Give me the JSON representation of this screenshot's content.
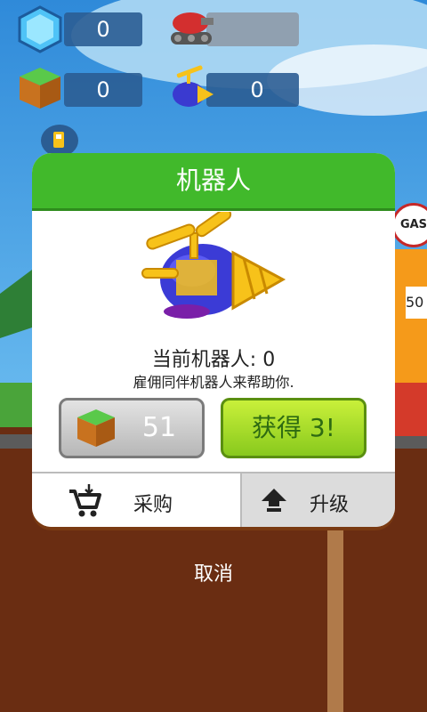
{
  "hud": {
    "gems_count": "0",
    "blocks_count": "0",
    "robots_count": "0"
  },
  "dialog": {
    "title": "机器人",
    "robot_count_label": "当前机器人: 0",
    "description": "雇佣同伴机器人来帮助你.",
    "price": "51",
    "get_label": "获得 3!",
    "tabs": {
      "purchase": "采购",
      "upgrade": "升级"
    }
  },
  "cancel_label": "取消",
  "side": {
    "gas_sign": "GAS",
    "price_sign": "50"
  },
  "colors": {
    "header_green": "#41b92b",
    "button_green": "#a8dc2a",
    "hud_blue": "#2b5d93"
  },
  "icons": [
    "gem-icon",
    "tank-robot-icon",
    "grass-block-icon",
    "drill-robot-icon",
    "cart-icon",
    "upgrade-arrow-icon",
    "gas-pump-icon"
  ]
}
